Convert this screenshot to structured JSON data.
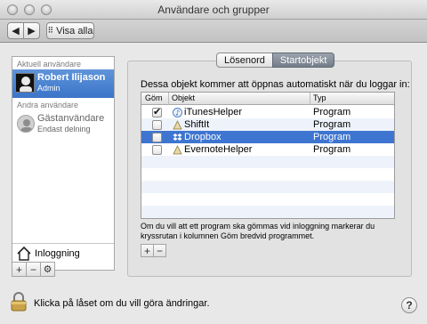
{
  "window": {
    "title": "Användare och grupper"
  },
  "toolbar": {
    "back_icon": "chevron-left",
    "forward_icon": "chevron-right",
    "grid_icon": "grid",
    "show_all_label": "Visa alla"
  },
  "sidebar": {
    "current_header": "Aktuell användare",
    "current_user": {
      "name": "Robert Ilijason",
      "role": "Admin"
    },
    "other_header": "Andra användare",
    "guest_user": {
      "name": "Gästanvändare",
      "role": "Endast delning"
    },
    "login_label": "Inloggning",
    "add_label": "+",
    "remove_label": "−",
    "settings_icon": "gear"
  },
  "tabs": [
    {
      "label": "Lösenord"
    },
    {
      "label": "Startobjekt"
    }
  ],
  "panel": {
    "title": "Dessa objekt kommer att öppnas automatiskt när du loggar in:",
    "columns": {
      "hide": "Göm",
      "item": "Objekt",
      "type": "Typ"
    },
    "rows": [
      {
        "hidden": true,
        "name": "iTunesHelper",
        "type": "Program",
        "icon": "itunes"
      },
      {
        "hidden": false,
        "name": "ShiftIt",
        "type": "Program",
        "icon": "app"
      },
      {
        "hidden": false,
        "name": "Dropbox",
        "type": "Program",
        "icon": "dropbox"
      },
      {
        "hidden": false,
        "name": "EvernoteHelper",
        "type": "Program",
        "icon": "app"
      }
    ],
    "selected_row": 2,
    "hint": "Om du vill att ett program ska gömmas vid inloggning markerar du kryssrutan i kolumnen Göm bredvid programmet.",
    "add_label": "+",
    "remove_label": "−"
  },
  "bottom": {
    "lock_text": "Klicka på låset om du vill göra ändringar.",
    "help_label": "?"
  },
  "colors": {
    "selection": "#3d75d0",
    "sidebar_selection": "#4a82d2",
    "background": "#e8e8e8"
  }
}
